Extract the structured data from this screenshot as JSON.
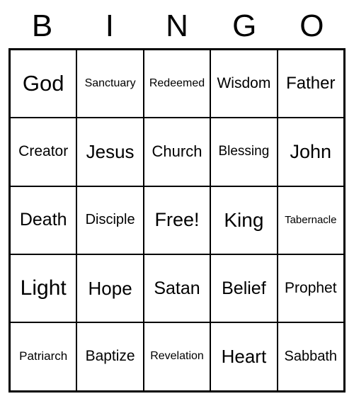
{
  "header": {
    "letters": [
      "B",
      "I",
      "N",
      "G",
      "O"
    ]
  },
  "grid": {
    "rows": [
      [
        "God",
        "Sanctuary",
        "Redeemed",
        "Wisdom",
        "Father"
      ],
      [
        "Creator",
        "Jesus",
        "Church",
        "Blessing",
        "John"
      ],
      [
        "Death",
        "Disciple",
        "Free!",
        "King",
        "Tabernacle"
      ],
      [
        "Light",
        "Hope",
        "Satan",
        "Belief",
        "Prophet"
      ],
      [
        "Patriarch",
        "Baptize",
        "Revelation",
        "Heart",
        "Sabbath"
      ]
    ]
  },
  "cell_font_sizes": {
    "base": 18,
    "sizes": [
      [
        31,
        16,
        16,
        21,
        24
      ],
      [
        21,
        26,
        22,
        19,
        27
      ],
      [
        25,
        20,
        27,
        28,
        15
      ],
      [
        30,
        26,
        25,
        25,
        21
      ],
      [
        17,
        21,
        16,
        26,
        20
      ]
    ]
  }
}
